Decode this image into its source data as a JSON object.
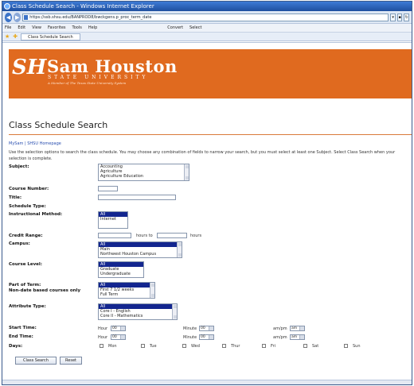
{
  "window": {
    "title": "Class Schedule Search - Windows Internet Explorer"
  },
  "browser": {
    "address": "https://ssb.shsu.edu/BANPROD8/bwckgens.p_proc_term_date",
    "menu": [
      "File",
      "Edit",
      "View",
      "Favorites",
      "Tools",
      "Help"
    ],
    "convert_label": "Convert",
    "select_label": "Select",
    "tab_label": "Class Schedule Search"
  },
  "banner": {
    "logo_letters": "SH",
    "name": "Sam Houston",
    "subtitle": "STATE UNIVERSITY",
    "tagline": "A Member of The Texas State University System"
  },
  "page": {
    "title": "Class Schedule Search",
    "links": "MySam | SHSU Homepage",
    "intro": "Use the selection options to search the class schedule. You may choose any combination of fields to narrow your search, but you must select at least one Subject. Select Class Search when your selection is complete."
  },
  "form": {
    "subject": {
      "label": "Subject:",
      "options": [
        "Accounting",
        "Agriculture",
        "Agriculture Education"
      ]
    },
    "course_number": {
      "label": "Course Number:"
    },
    "title": {
      "label": "Title:"
    },
    "schedule_type": {
      "label": "Schedule Type:"
    },
    "instructional_method": {
      "label": "Instructional Method:",
      "options": [
        "All",
        "Internet"
      ],
      "selected": "All"
    },
    "credit_range": {
      "label": "Credit Range:",
      "to_text": "hours to",
      "hours_text": "hours"
    },
    "campus": {
      "label": "Campus:",
      "options": [
        "All",
        "Main",
        "Northwest Houston Campus"
      ],
      "selected": "All"
    },
    "course_level": {
      "label": "Course Level:",
      "options": [
        "All",
        "Graduate",
        "Undergraduate"
      ],
      "selected": "All"
    },
    "part_of_term": {
      "label": "Part of Term:",
      "label2": "Non-date based courses only",
      "options": [
        "All",
        "First 7 1/2 weeks",
        "Full Term"
      ],
      "selected": "All"
    },
    "attribute_type": {
      "label": "Attribute Type:",
      "options": [
        "All",
        "Core I - English",
        "Core II - Mathematics"
      ],
      "selected": "All"
    },
    "start_time": {
      "label": "Start Time:",
      "hour_label": "Hour",
      "hour": "00",
      "minute_label": "Minute",
      "minute": "00",
      "ampm_label": "am/pm",
      "ampm": "am"
    },
    "end_time": {
      "label": "End Time:",
      "hour_label": "Hour",
      "hour": "00",
      "minute_label": "Minute",
      "minute": "00",
      "ampm_label": "am/pm",
      "ampm": "am"
    },
    "days": {
      "label": "Days:",
      "items": [
        "Mon",
        "Tue",
        "Wed",
        "Thur",
        "Fri",
        "Sat",
        "Sun"
      ]
    },
    "search_button": "Class Search",
    "reset_button": "Reset"
  },
  "colors": {
    "banner": "#e06a1f",
    "selected": "#13268f",
    "link": "#2a4fb0"
  }
}
